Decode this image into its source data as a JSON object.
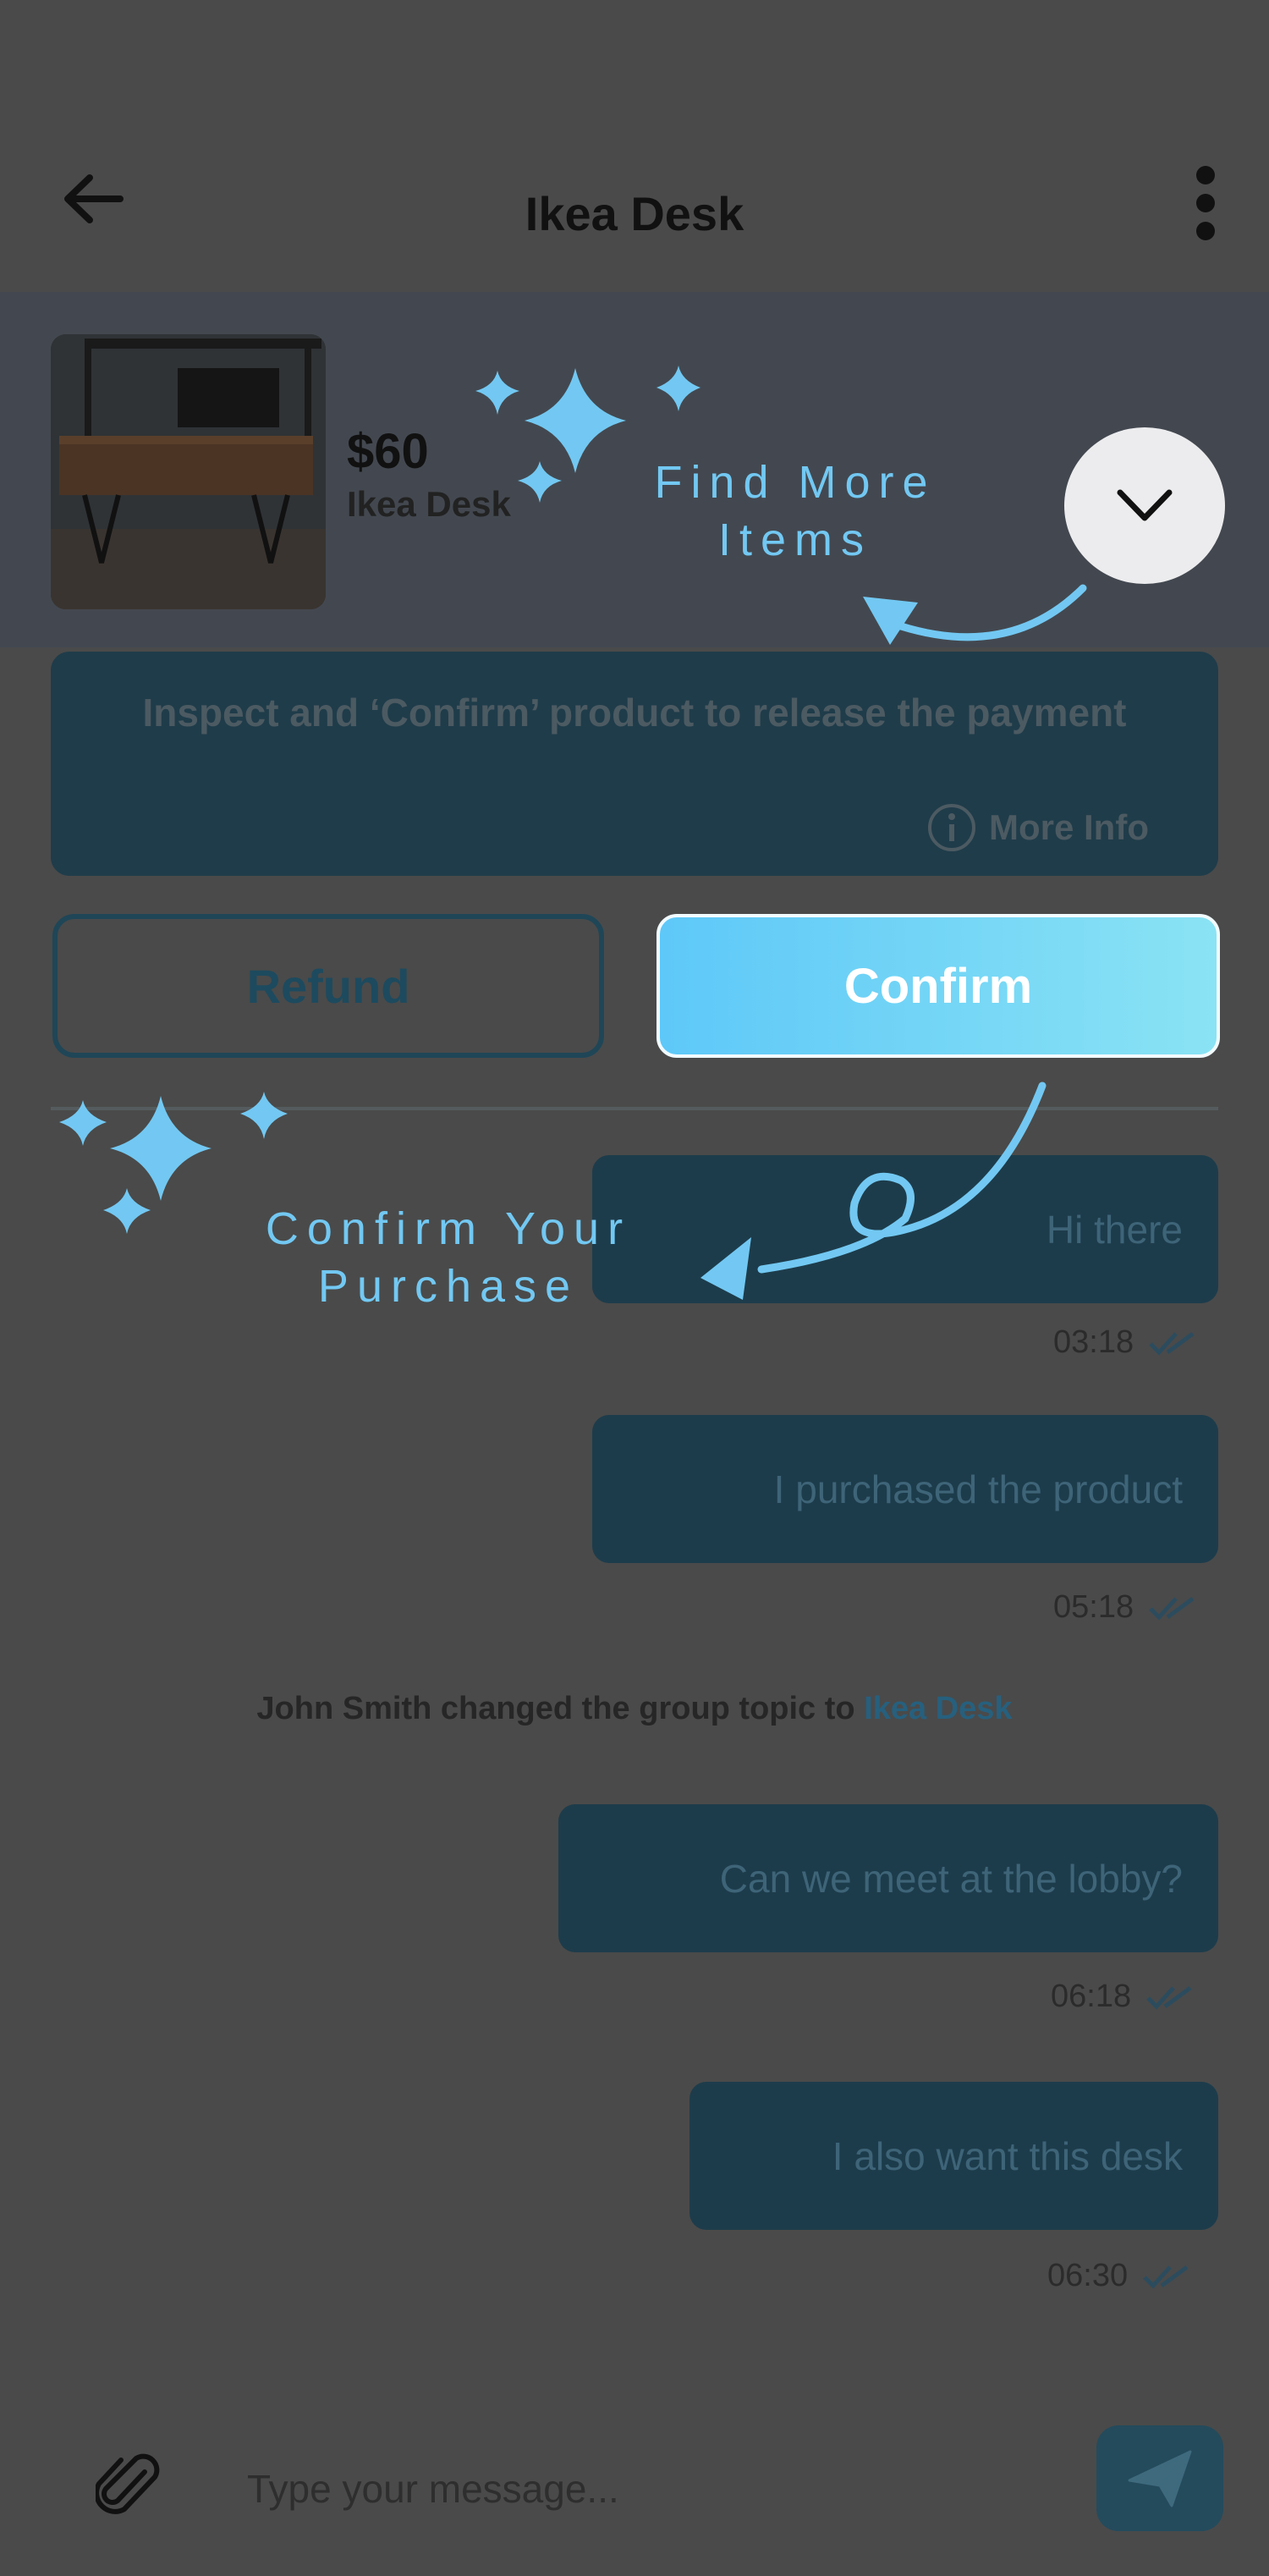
{
  "header": {
    "title": "Ikea Desk"
  },
  "product": {
    "price": "$60",
    "name": "Ikea Desk"
  },
  "info": {
    "text": "Inspect and ‘Confirm’ product to release the payment",
    "more_info_label": "More Info"
  },
  "actions": {
    "refund_label": "Refund",
    "confirm_label": "Confirm"
  },
  "messages": [
    {
      "text": "Hi there",
      "time": "03:18"
    },
    {
      "text": "I purchased the product",
      "time": "05:18"
    },
    {
      "text": "Can we meet at the lobby?",
      "time": "06:18"
    },
    {
      "text": "I also want this desk",
      "time": "06:30"
    }
  ],
  "system_message": {
    "text": "John Smith changed the group topic to ",
    "topic": "Ikea Desk"
  },
  "composer": {
    "placeholder": "Type your message..."
  },
  "callouts": {
    "find_more_line1": "Find More",
    "find_more_line2": "Items",
    "confirm_line1": "Confirm Your",
    "confirm_line2": "Purchase"
  },
  "colors": {
    "accent": "#72c8f2",
    "confirm_start": "#5ec8f8",
    "confirm_end": "#8ae3f4",
    "bubble": "#1d3c4b",
    "overlay_bg": "#4a4a4a"
  },
  "icons": [
    "arrow-left-icon",
    "kebab-menu-icon",
    "chevron-down-icon",
    "info-icon",
    "double-check-icon",
    "paperclip-icon",
    "send-icon",
    "sparkle-icon",
    "curved-arrow-icon"
  ]
}
